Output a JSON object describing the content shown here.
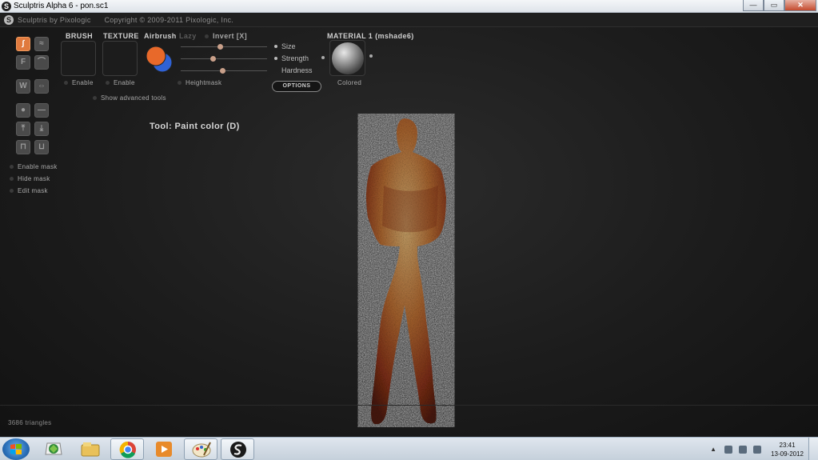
{
  "window": {
    "title": "Sculptris Alpha 6 - pon.sc1",
    "minimize_icon": "minimize-icon",
    "maximize_icon": "restore-icon",
    "close_icon": "close-icon",
    "min_glyph": "—",
    "max_glyph": "▭",
    "close_glyph": "✕"
  },
  "app_header": {
    "product": "Sculptris by Pixologic",
    "copyright": "Copyright © 2009-2011 Pixologic, Inc."
  },
  "tools": [
    {
      "icon": "draw-icon",
      "glyph": "∫",
      "active": true
    },
    {
      "icon": "crease-icon",
      "glyph": "≈",
      "active": false
    },
    {
      "icon": "flatten-icon",
      "glyph": "F",
      "active": false
    },
    {
      "icon": "inflate-icon",
      "glyph": "⌒",
      "active": false
    },
    {
      "icon": "pinch-icon",
      "glyph": "W",
      "active": false
    },
    {
      "icon": "smooth-icon",
      "glyph": "⇔",
      "active": false
    },
    {
      "icon": "grab-icon",
      "glyph": "●",
      "active": false
    },
    {
      "icon": "scale-icon",
      "glyph": "—",
      "active": false
    },
    {
      "icon": "rotate-icon",
      "glyph": "⤒",
      "active": false
    },
    {
      "icon": "reduce-icon",
      "glyph": "⤓",
      "active": false
    },
    {
      "icon": "mask-icon",
      "glyph": "⊓",
      "active": false
    },
    {
      "icon": "unmask-icon",
      "glyph": "⊔",
      "active": false
    }
  ],
  "mask": {
    "enable": "Enable mask",
    "hide": "Hide mask",
    "edit": "Edit mask"
  },
  "panel": {
    "brush_label": "BRUSH",
    "texture_label": "TEXTURE",
    "airbrush_label": "Airbrush",
    "lazy_label": "Lazy",
    "invert_label": "Invert [X]",
    "brush_enable": "Enable",
    "texture_enable": "Enable",
    "heightmask": "Heightmask",
    "show_advanced": "Show advanced tools",
    "size_label": "Size",
    "strength_label": "Strength",
    "hardness_label": "Hardness",
    "options_label": "OPTIONS",
    "material_label": "MATERIAL 1 (mshade6)",
    "colored_label": "Colored",
    "size_value": 0.45,
    "strength_value": 0.37,
    "hardness_value": 0.48,
    "primary_color": "#e8692a",
    "secondary_color": "#2f62d6"
  },
  "status": {
    "tool": "Tool: Paint color (D)",
    "triangles": "3686 triangles"
  },
  "taskbar": {
    "items": [
      {
        "icon": "start-orb-icon"
      },
      {
        "icon": "vlc-icon"
      },
      {
        "icon": "explorer-folder-icon"
      },
      {
        "icon": "chrome-icon"
      },
      {
        "icon": "media-player-icon"
      },
      {
        "icon": "paint-icon"
      },
      {
        "icon": "sculptris-icon"
      }
    ],
    "time": "23:41",
    "date": "13-09-2012"
  }
}
